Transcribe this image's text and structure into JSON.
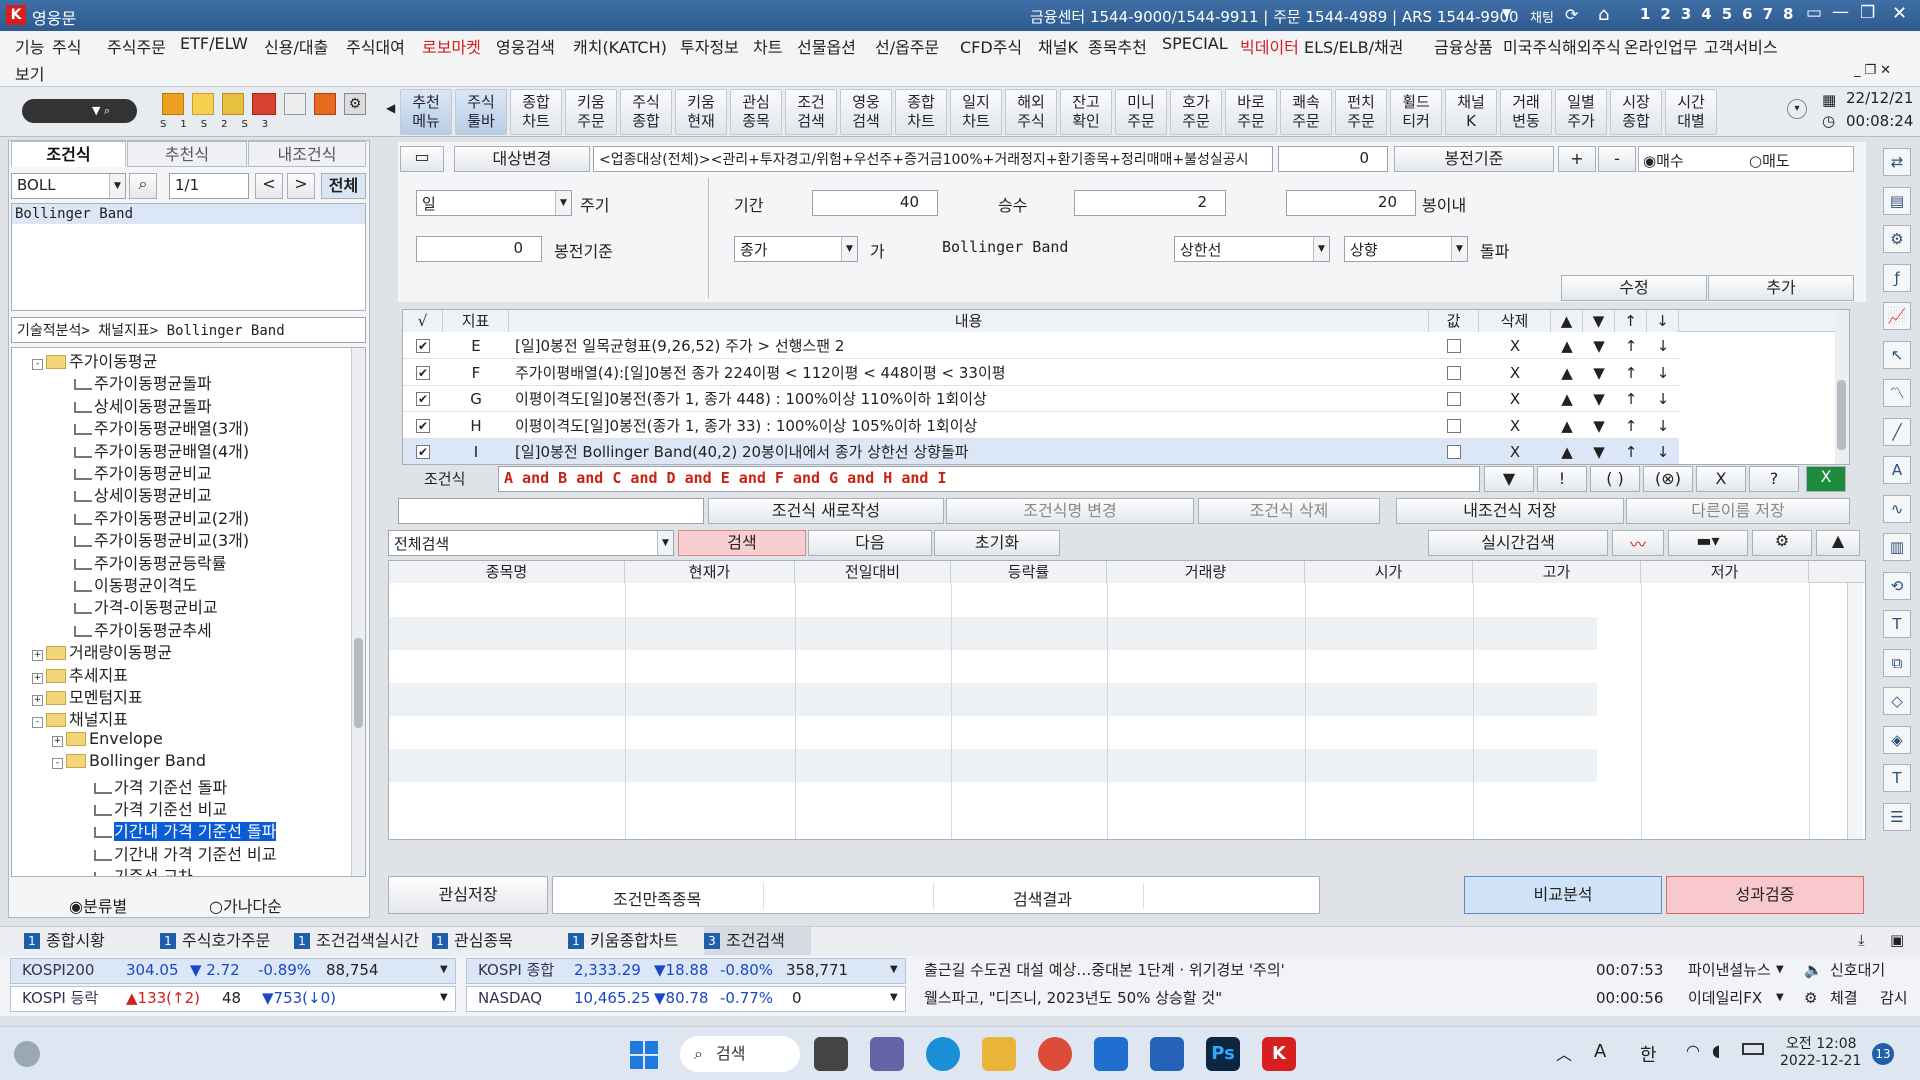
{
  "titlebar": {
    "app": "영웅문",
    "contact": "금융센터 1544-9000/1544-9911 | 주문 1544-4989 | ARS 1544-9900",
    "chat": "채팅",
    "screens": [
      "1",
      "2",
      "3",
      "4",
      "5",
      "6",
      "7",
      "8"
    ]
  },
  "menu": {
    "row1": [
      "기능",
      "주식",
      "주식주문",
      "ETF/ELW",
      "신용/대출",
      "주식대여",
      "로보마켓",
      "영웅검색",
      "캐치(KATCH)",
      "투자정보",
      "차트",
      "선물옵션",
      "선/옵주문",
      "CFD주식",
      "채널K",
      "종목추천",
      "SPECIAL",
      "빅데이터",
      "ELS/ELB/채권",
      "금융상품",
      "미국주식",
      "해외주식",
      "온라인업무",
      "고객서비스"
    ],
    "row2": [
      "보기"
    ]
  },
  "toolbar": {
    "tabs": [
      "S1",
      "S2",
      "S3"
    ],
    "buttons": [
      "추천\n메뉴",
      "주식\n툴바",
      "종합\n차트",
      "키움\n주문",
      "주식\n종합",
      "키움\n현재",
      "관심\n종목",
      "조건\n검색",
      "영웅\n검색",
      "종합\n차트",
      "일지\n차트",
      "해외\n주식",
      "잔고\n확인",
      "미니\n주문",
      "호가\n주문",
      "바로\n주문",
      "쾌속\n주문",
      "펀치\n주문",
      "휠드\n티커",
      "채널\nK",
      "거래\n변동",
      "일별\n주가",
      "시장\n종합",
      "시간\n대별"
    ],
    "date": "22/12/21",
    "time": "00:08:24"
  },
  "left": {
    "tabs": [
      "조건식",
      "추천식",
      "내조건식"
    ],
    "search_value": "BOLL",
    "page": "1/1",
    "all_button": "전체",
    "result": "Bollinger Band",
    "path": "기술적분석> 채널지표> Bollinger Band",
    "tree": [
      {
        "label": "주가이동평균",
        "level": 1,
        "kind": "folder",
        "exp": "-"
      },
      {
        "label": "주가이동평균돌파",
        "level": 2,
        "kind": "item"
      },
      {
        "label": "상세이동평균돌파",
        "level": 2,
        "kind": "item"
      },
      {
        "label": "주가이동평균배열(3개)",
        "level": 2,
        "kind": "item"
      },
      {
        "label": "주가이동평균배열(4개)",
        "level": 2,
        "kind": "item"
      },
      {
        "label": "주가이동평균비교",
        "level": 2,
        "kind": "item"
      },
      {
        "label": "상세이동평균비교",
        "level": 2,
        "kind": "item"
      },
      {
        "label": "주가이동평균비교(2개)",
        "level": 2,
        "kind": "item"
      },
      {
        "label": "주가이동평균비교(3개)",
        "level": 2,
        "kind": "item"
      },
      {
        "label": "주가이동평균등락률",
        "level": 2,
        "kind": "item"
      },
      {
        "label": "이동평균이격도",
        "level": 2,
        "kind": "item"
      },
      {
        "label": "가격-이동평균비교",
        "level": 2,
        "kind": "item"
      },
      {
        "label": "주가이동평균추세",
        "level": 2,
        "kind": "item"
      },
      {
        "label": "거래량이동평균",
        "level": 1,
        "kind": "folder",
        "exp": "+"
      },
      {
        "label": "추세지표",
        "level": 1,
        "kind": "folder",
        "exp": "+"
      },
      {
        "label": "모멘텀지표",
        "level": 1,
        "kind": "folder",
        "exp": "+"
      },
      {
        "label": "채널지표",
        "level": 1,
        "kind": "folder",
        "exp": "-"
      },
      {
        "label": "Envelope",
        "level": 2,
        "kind": "folder",
        "exp": "+"
      },
      {
        "label": "Bollinger Band",
        "level": 2,
        "kind": "folder",
        "exp": "-"
      },
      {
        "label": "가격 기준선 돌파",
        "level": 3,
        "kind": "item"
      },
      {
        "label": "가격 기준선 비교",
        "level": 3,
        "kind": "item"
      },
      {
        "label": "기간내 가격 기준선 돌파",
        "level": 3,
        "kind": "item",
        "selected": true
      },
      {
        "label": "기간내 가격 기준선 비교",
        "level": 3,
        "kind": "item"
      },
      {
        "label": "기준선 교차",
        "level": 3,
        "kind": "item"
      }
    ],
    "radio": [
      "분류별",
      "가나다순"
    ]
  },
  "condition": {
    "target_btn": "대상변경",
    "target_text": "<업종대상(전체)><관리+투자경고/위험+우선주+증거금100%+거래정지+환기종목+정리매매+불성실공시",
    "target_num": "0",
    "bong_btn": "봉전기준",
    "plus": "+",
    "minus": "-",
    "buy": "매수",
    "sell": "매도",
    "period_value": "일",
    "period_label": "주기",
    "term_label": "기간",
    "term_value": "40",
    "mult_label": "승수",
    "mult_value": "2",
    "within_value": "20",
    "within_label": "봉이내",
    "bong_value": "0",
    "bong_label": "봉전기준",
    "price_value": "종가",
    "price_suffix": "가",
    "indicator": "Bollinger Band",
    "line_value": "상한선",
    "dir_value": "상향",
    "cross_label": "돌파",
    "modify": "수정",
    "add": "추가"
  },
  "cond_table": {
    "headers": [
      "√",
      "지표",
      "내용",
      "값",
      "삭제",
      "▲",
      "▼",
      "↑",
      "↓"
    ],
    "rows": [
      {
        "id": "E",
        "text": "[일]0봉전 일목균형표(9,26,52) 주가 > 선행스팬 2"
      },
      {
        "id": "F",
        "text": "주가이평배열(4):[일]0봉전 종가 224이평 < 112이평 < 448이평 < 33이평"
      },
      {
        "id": "G",
        "text": "이평이격도[일]0봉전(종가 1, 종가 448) : 100%이상 110%이하 1회이상"
      },
      {
        "id": "H",
        "text": "이평이격도[일]0봉전(종가 1, 종가 33) : 100%이상 105%이하 1회이상"
      },
      {
        "id": "I",
        "text": "[일]0봉전 Bollinger Band(40,2) 20봉이내에서 종가 상한선 상향돌파"
      }
    ],
    "x": "X"
  },
  "formula": {
    "label": "조건식",
    "text": "A and B and C and D and E and F and G and H and I",
    "btns": [
      "▼",
      "!",
      "( )",
      "(⊗)",
      "X",
      "?"
    ]
  },
  "actions": [
    "조건식 새로작성",
    "조건식명 변경",
    "조건식 삭제",
    "내조건식 저장",
    "다른이름 저장"
  ],
  "search": {
    "scope": "전체검색",
    "search": "검색",
    "next": "다음",
    "reset": "초기화",
    "realtime": "실시간검색"
  },
  "results": {
    "headers": [
      "종목명",
      "현재가",
      "전일대비",
      "등락률",
      "거래량",
      "시가",
      "고가",
      "저가"
    ]
  },
  "bottom": {
    "save": "관심저장",
    "tabs": [
      "조건만족종목",
      "검색결과"
    ],
    "compare": "비교분석",
    "perf": "성과검증"
  },
  "screen_tabs": [
    {
      "n": "1",
      "label": "종합시황"
    },
    {
      "n": "1",
      "label": "주식호가주문"
    },
    {
      "n": "1",
      "label": "조건검색실시간"
    },
    {
      "n": "1",
      "label": "관심종목"
    },
    {
      "n": "1",
      "label": "키움종합차트"
    },
    {
      "n": "3",
      "label": "조건검색"
    }
  ],
  "ticker": {
    "r1": [
      "KOSPI200",
      "304.05",
      "▼ 2.72",
      "-0.89%",
      "88,754",
      "KOSPI 종합",
      "2,333.29",
      "▼18.88",
      "-0.80%",
      "358,771",
      "출근길 수도권 대설 예상…중대본 1단계 · 위기경보 '주의'",
      "00:07:53",
      "파이낸셜뉴스",
      "신호대기"
    ],
    "r2": [
      "KOSPI 등락",
      "▲133(↑2)",
      "48",
      "▼753(↓0)",
      "NASDAQ",
      "10,465.25",
      "▼80.78",
      "-0.77%",
      "0",
      "웰스파고, \"디즈니, 2023년도 50% 상승할 것\"",
      "00:00:56",
      "이데일리FX",
      "체결",
      "감시"
    ]
  },
  "taskbar": {
    "search": "검색",
    "time": "오전 12:08",
    "date": "2022-12-21",
    "badge": "13",
    "lang": "한",
    "ime": "A"
  }
}
